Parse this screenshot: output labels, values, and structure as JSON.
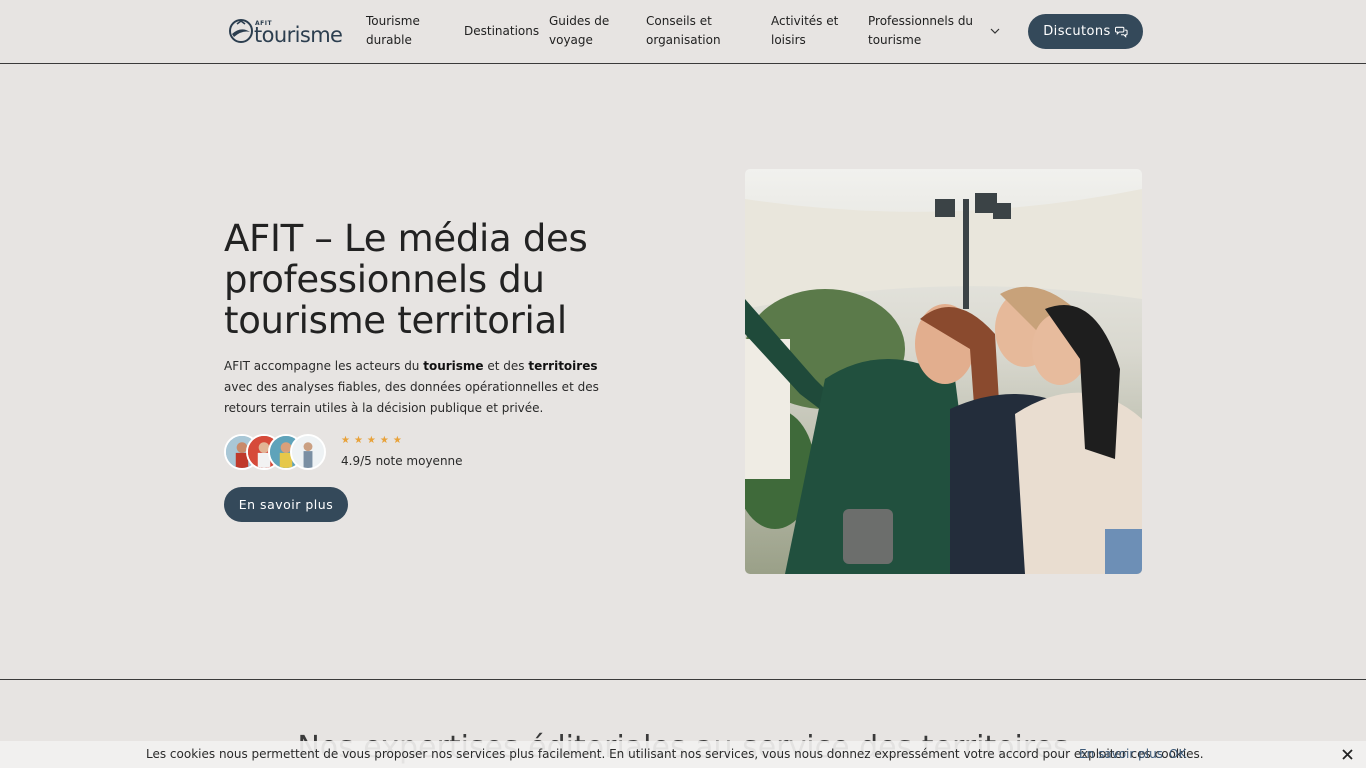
{
  "header": {
    "logo_small": "AFIT",
    "logo_text": "tourisme",
    "nav": [
      {
        "line1": "Tourisme",
        "line2": "durable"
      },
      {
        "line1": "Destinations",
        "line2": ""
      },
      {
        "line1": "Guides de",
        "line2": "voyage"
      },
      {
        "line1": "Conseils et",
        "line2": "organisation"
      },
      {
        "line1": "Activités et",
        "line2": "loisirs"
      },
      {
        "line1": "Professionnels du",
        "line2": "tourisme"
      }
    ],
    "cta_label": "Discutons"
  },
  "hero": {
    "title": "AFIT – Le média des professionnels du tourisme territorial",
    "desc_part1": "AFIT accompagne les acteurs du ",
    "desc_bold1": "tourisme",
    "desc_part2": " et des ",
    "desc_bold2": "territoires",
    "desc_part3": " avec des analyses fiables, des données opérationnelles et des retours terrain utiles à la décision publique et privée.",
    "stars": "★★★★★",
    "rating_value": 4.9,
    "rating_text": "4.9/5 note moyenne",
    "button_label": "En savoir plus"
  },
  "next_section": {
    "heading": "Nos expertises éditoriales au service des territoires"
  },
  "cookie": {
    "text": "Les cookies nous permettent de vous proposer nos services plus facilement. En utilisant nos services, vous nous donnez expressément votre accord pour exploiter ces cookies.",
    "link": "En savoir plus",
    "ok": "OK"
  },
  "colors": {
    "background": "#e7e4e2",
    "accent": "#34495a",
    "star": "#e8a23a",
    "link": "#3d5a78"
  },
  "icons": [
    "logo-emblem-icon",
    "chevron-down-icon",
    "chat-icon",
    "close-icon"
  ]
}
